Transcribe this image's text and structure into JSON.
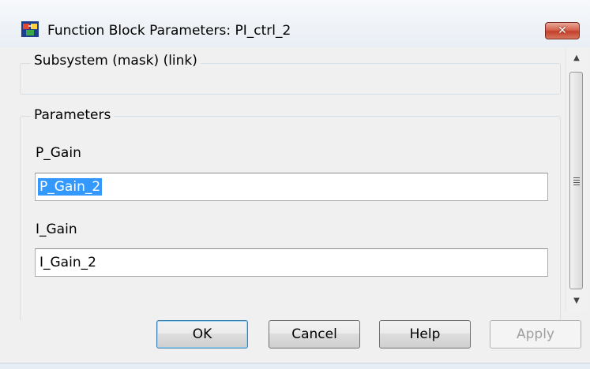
{
  "window": {
    "title": "Function Block Parameters: PI_ctrl_2",
    "close_label": "✕"
  },
  "subsystem_group": {
    "label": "Subsystem (mask) (link)"
  },
  "parameters_group": {
    "label": "Parameters",
    "fields": [
      {
        "label": "P_Gain",
        "value": "P_Gain_2",
        "selected": true
      },
      {
        "label": "I_Gain",
        "value": "I_Gain_2",
        "selected": false
      }
    ]
  },
  "buttons": {
    "ok": "OK",
    "cancel": "Cancel",
    "help": "Help",
    "apply": "Apply"
  },
  "colors": {
    "selection": "#3399ff",
    "close_button": "#c4402b",
    "default_button_border": "#3c7fb1"
  }
}
